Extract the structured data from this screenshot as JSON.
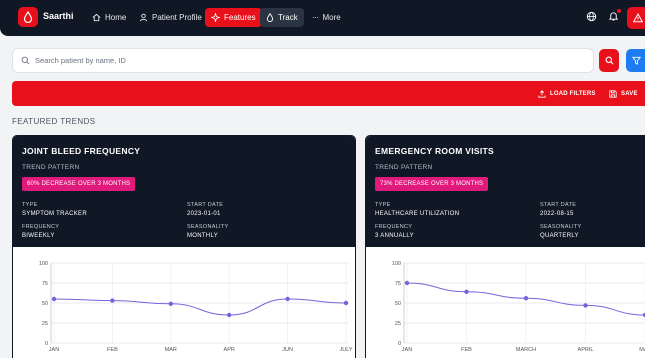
{
  "nav": {
    "brand": "Saarthi",
    "items": [
      {
        "label": "Home"
      },
      {
        "label": "Patient Profile"
      },
      {
        "label": "Features"
      },
      {
        "label": "Track"
      },
      {
        "label": "More"
      }
    ]
  },
  "search": {
    "placeholder": "Search patient by name, ID"
  },
  "actions": {
    "load_filters": "LOAD FILTERS",
    "save": "SAVE"
  },
  "section_title": "FEATURED TRENDS",
  "colors": {
    "accent_red": "#e8111b",
    "nav_dark": "#101826",
    "badge_pink": "#e0197d",
    "line_purple": "#7b61d9",
    "blue": "#1e7cf2"
  },
  "cards": [
    {
      "title": "JOINT BLEED FREQUENCY",
      "subtitle": "TREND PATTERN",
      "badge": "60% DECREASE OVER 3 MONTHS",
      "type_label": "TYPE",
      "type_value": "SYMPTOM TRACKER",
      "start_label": "START DATE",
      "start_value": "2023-01-01",
      "freq_label": "FREQUENCY",
      "freq_value": "BIWEEKLY",
      "season_label": "SEASONALITY",
      "season_value": "MONTHLY"
    },
    {
      "title": "EMERGENCY ROOM VISITS",
      "subtitle": "TREND PATTERN",
      "badge": "73% DECREASE OVER 3 MONTHS",
      "type_label": "TYPE",
      "type_value": "HEALTHCARE UTILIZATION",
      "start_label": "START DATE",
      "start_value": "2022-08-15",
      "freq_label": "FREQUENCY",
      "freq_value": "3 ANNUALLY",
      "season_label": "SEASONALITY",
      "season_value": "QUARTERLY"
    }
  ],
  "chart_data": [
    {
      "type": "line",
      "categories": [
        "JAN",
        "FEB",
        "MAR",
        "APR",
        "JUN",
        "JULY"
      ],
      "values": [
        55,
        53,
        49,
        35,
        55,
        50
      ],
      "yticks": [
        "100",
        "75",
        "50",
        "25",
        "0"
      ],
      "ylim": [
        0,
        100
      ],
      "grid": true
    },
    {
      "type": "line",
      "categories": [
        "JAN",
        "FEB",
        "MARCH",
        "APRIL",
        "MAY"
      ],
      "values": [
        75,
        64,
        56,
        47,
        35
      ],
      "yticks": [
        "100",
        "75",
        "50",
        "25",
        "0"
      ],
      "ylim": [
        0,
        100
      ],
      "grid": true
    }
  ]
}
